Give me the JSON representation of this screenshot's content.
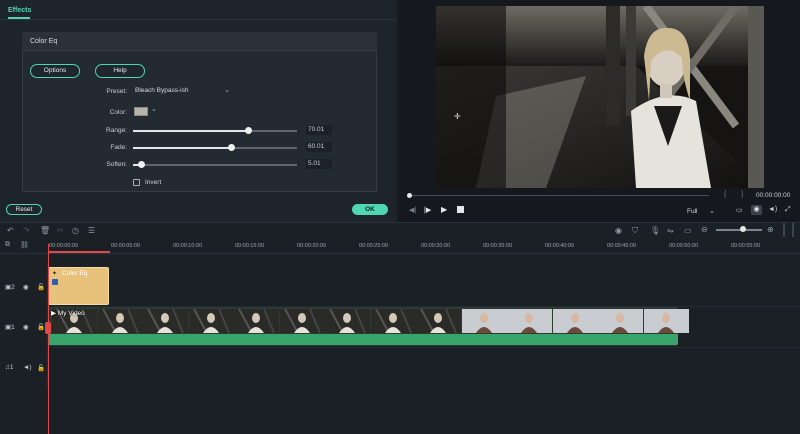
{
  "effects_panel": {
    "tab_label": "Effects",
    "effect_name": "Color Eq",
    "options_label": "Options",
    "help_label": "Help",
    "preset_label": "Preset:",
    "preset_value": "Bleach Bypass-ish",
    "color_label": "Color:",
    "color_value": "#b8b4ad",
    "sliders": [
      {
        "label": "Range:",
        "value": "70.01",
        "level": 0.7
      },
      {
        "label": "Fade:",
        "value": "60.01",
        "level": 0.6
      },
      {
        "label": "Soften:",
        "value": "5.01",
        "level": 0.05
      }
    ],
    "invert_label": "Invert",
    "reset_label": "Reset",
    "ok_label": "OK"
  },
  "preview": {
    "timecode": "00:00:00:00",
    "quality": "Full",
    "progress": 0.0
  },
  "timeline": {
    "ruler": [
      "00:00:00:00",
      "00:00:05:00",
      "00:00:10:00",
      "00:00:15:00",
      "00:00:20:00",
      "00:00:25:00",
      "00:00:30:00",
      "00:00:35:00",
      "00:00:40:00",
      "00:00:45:00",
      "00:00:50:00",
      "00:00:55:00"
    ],
    "tracks": [
      {
        "number": "2",
        "clip_label": "Color Eq"
      },
      {
        "number": "1",
        "clip_label": "My Video"
      },
      {
        "number": "1"
      }
    ]
  },
  "colors": {
    "accent": "#4fd6b4",
    "playhead": "#e04848",
    "effect_clip": "#e8c27a",
    "video_clip": "#3aa56a"
  },
  "icons": [
    "undo-icon",
    "redo-icon",
    "delete-icon",
    "cut-icon",
    "speed-icon",
    "settings-icon",
    "render-icon",
    "marker-icon",
    "mic-icon",
    "split-icon",
    "zoom-out-icon",
    "zoom-in-icon",
    "eye-icon",
    "lock-icon",
    "volume-icon",
    "play-icon",
    "stop-icon",
    "prev-frame-icon",
    "next-frame-icon",
    "fullscreen-icon",
    "snapshot-icon",
    "audio-icon"
  ]
}
